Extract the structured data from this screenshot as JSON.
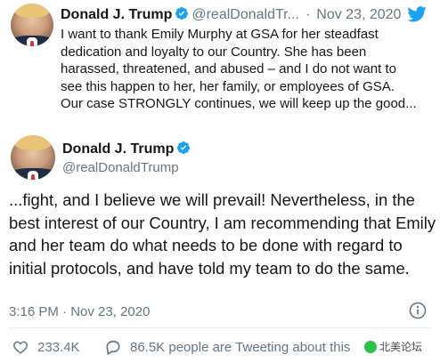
{
  "tweet1": {
    "name": "Donald J. Trump",
    "handle": "@realDonaldTr...",
    "separator": "·",
    "date": "Nov 23, 2020",
    "text": "I want to thank Emily Murphy at GSA for her steadfast dedication and loyalty to our Country. She has been harassed, threatened, and abused – and I do not want to see this happen to her, her family, or employees of GSA. Our case STRONGLY continues, we will keep up the good..."
  },
  "tweet2": {
    "name": "Donald J. Trump",
    "handle": "@realDonaldTrump",
    "text": "...fight, and I believe we will prevail! Nevertheless, in the best interest of our Country, I am recommending that Emily and her team do what needs to be done with regard to initial protocols, and have told my team to do the same.",
    "timestamp": "3:16 PM · Nov 23, 2020"
  },
  "footer": {
    "likes": "233.4K",
    "tweeting": "86.5K people are Tweeting about this"
  },
  "watermark": {
    "right": "北美论坛"
  },
  "icons": {
    "verified": "verified-badge-icon",
    "bird": "twitter-bird-icon",
    "info": "info-icon",
    "like": "heart-icon",
    "reply": "speech-bubble-icon",
    "chevron": "chevron-right-icon"
  },
  "colors": {
    "twitter_blue": "#1da1f2",
    "text": "#14171a",
    "muted": "#657786"
  }
}
